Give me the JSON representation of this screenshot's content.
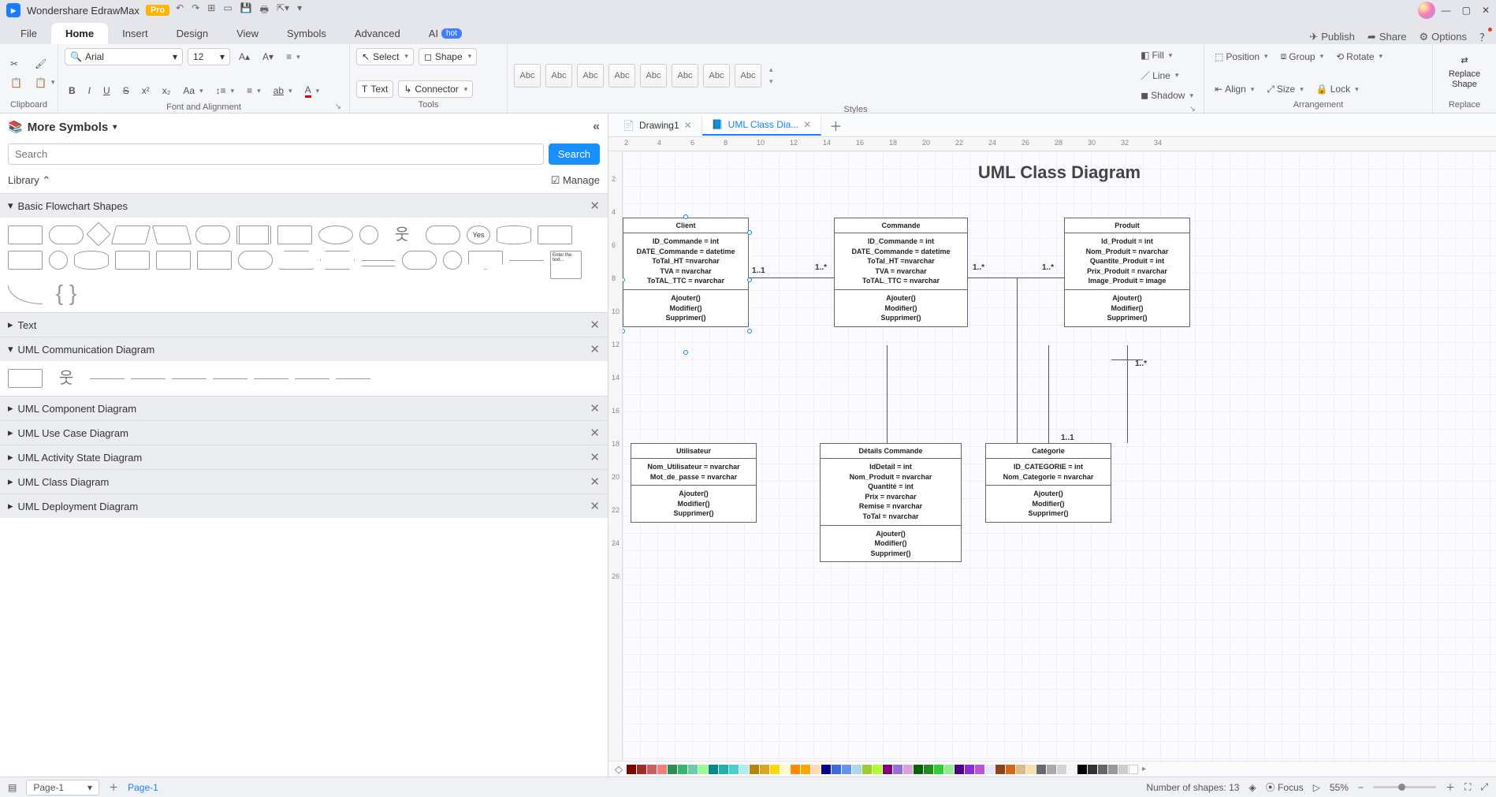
{
  "app": {
    "title": "Wondershare EdrawMax",
    "badge": "Pro"
  },
  "menu": {
    "tabs": [
      "File",
      "Home",
      "Insert",
      "Design",
      "View",
      "Symbols",
      "Advanced",
      "AI"
    ],
    "active": "Home",
    "hot": "hot",
    "right": {
      "publish": "Publish",
      "share": "Share",
      "options": "Options"
    }
  },
  "ribbon": {
    "clipboard_label": "Clipboard",
    "font": {
      "family": "Arial",
      "size": "12"
    },
    "font_label": "Font and Alignment",
    "tools": {
      "select": "Select",
      "text": "Text",
      "shape": "Shape",
      "connector": "Connector",
      "label": "Tools"
    },
    "styles": {
      "swatch": "Abc",
      "label": "Styles",
      "fill": "Fill",
      "line": "Line",
      "shadow": "Shadow"
    },
    "arrangement": {
      "position": "Position",
      "group": "Group",
      "rotate": "Rotate",
      "align": "Align",
      "size": "Size",
      "lock": "Lock",
      "label": "Arrangement"
    },
    "replace": {
      "btn": "Replace Shape",
      "label": "Replace"
    }
  },
  "symbols": {
    "title": "More Symbols",
    "search_placeholder": "Search",
    "search_btn": "Search",
    "library": "Library",
    "manage": "Manage",
    "categories": [
      "Basic Flowchart Shapes",
      "Text",
      "UML Communication Diagram",
      "UML Component Diagram",
      "UML Use Case Diagram",
      "UML Activity State Diagram",
      "UML Class Diagram",
      "UML Deployment Diagram"
    ]
  },
  "doc_tabs": {
    "tab1": "Drawing1",
    "tab2": "UML Class Dia..."
  },
  "diagram": {
    "title": "UML Class Diagram",
    "classes": {
      "client": {
        "name": "Client",
        "attrs": "ID_Commande = int\nDATE_Commande = datetime\nToTal_HT =nvarchar\nTVA = nvarchar\nToTAL_TTC = nvarchar",
        "ops": "Ajouter()\nModifier()\nSupprimer()"
      },
      "commande": {
        "name": "Commande",
        "attrs": "ID_Commande = int\nDATE_Commande = datetime\nToTal_HT =nvarchar\nTVA = nvarchar\nToTAL_TTC = nvarchar",
        "ops": "Ajouter()\nModifier()\nSupprimer()"
      },
      "produit": {
        "name": "Produit",
        "attrs": "Id_Produit = int\nNom_Produit = nvarchar\nQuantite_Produit = int\nPrix_Produit = nvarchar\nImage_Produit = image",
        "ops": "Ajouter()\nModifier()\nSupprimer()"
      },
      "utilisateur": {
        "name": "Utilisateur",
        "attrs": "Nom_Utilisateur = nvarchar\nMot_de_passe = nvarchar",
        "ops": "Ajouter()\nModifier()\nSupprimer()"
      },
      "details": {
        "name": "Détails Commande",
        "attrs": "IdDetail = int\nNom_Produit = nvarchar\nQuantité = int\nPrix = nvarchar\nRemise = nvarchar\nToTal = nvarchar",
        "ops": "Ajouter()\nModifier()\nSupprimer()"
      },
      "categorie": {
        "name": "Catégorie",
        "attrs": "ID_CATEGORIE = int\nNom_Categorie = nvarchar",
        "ops": "Ajouter()\nModifier()\nSupprimer()"
      }
    },
    "rel": {
      "r11": "1..1",
      "r1s": "1..*"
    }
  },
  "ruler_h": [
    "2",
    "4",
    "6",
    "8",
    "10",
    "12",
    "14",
    "16",
    "18",
    "20",
    "22",
    "24",
    "26",
    "28",
    "30",
    "32",
    "34"
  ],
  "ruler_v": [
    "2",
    "4",
    "6",
    "8",
    "10",
    "12",
    "14",
    "16",
    "18",
    "20",
    "22",
    "24",
    "26"
  ],
  "status": {
    "page_sel": "Page-1",
    "page_link": "Page-1",
    "shapes": "Number of shapes: 13",
    "focus": "Focus",
    "zoom": "55%"
  }
}
